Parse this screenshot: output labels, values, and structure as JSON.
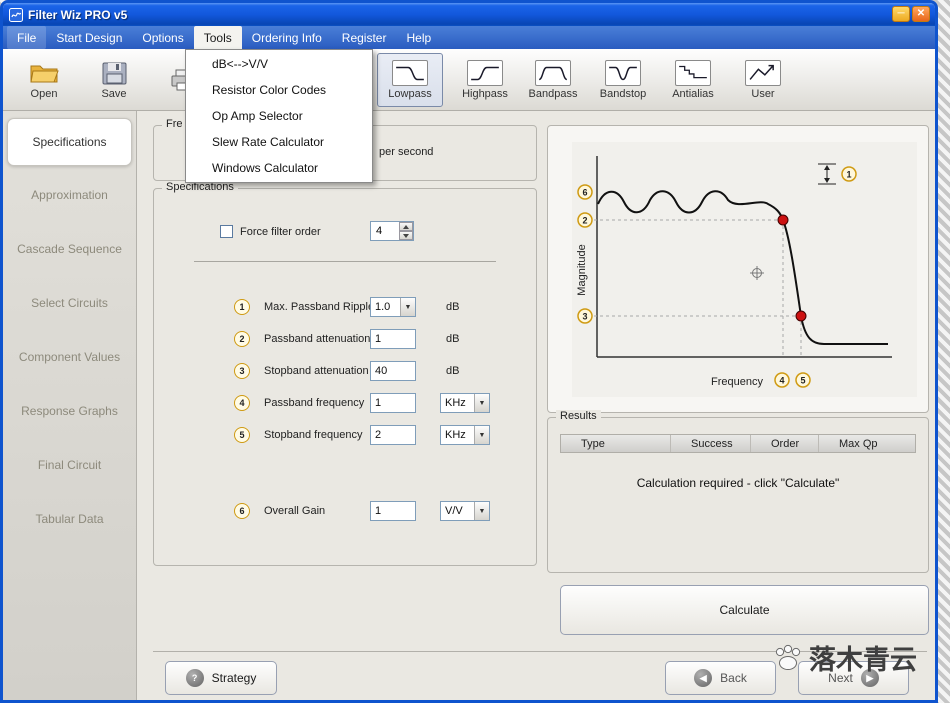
{
  "window": {
    "title": "Filter Wiz PRO v5"
  },
  "menu": {
    "items": [
      {
        "label": "File"
      },
      {
        "label": "Start Design"
      },
      {
        "label": "Options"
      },
      {
        "label": "Tools",
        "open": true
      },
      {
        "label": "Ordering Info"
      },
      {
        "label": "Register"
      },
      {
        "label": "Help"
      }
    ],
    "dropdown": [
      "dB<-->V/V",
      "Resistor Color Codes",
      "Op Amp Selector",
      "Slew Rate Calculator",
      "Windows Calculator"
    ]
  },
  "toolbar": {
    "open_label": "Open",
    "save_label": "Save",
    "filters": [
      {
        "label": "Lowpass",
        "selected": true
      },
      {
        "label": "Highpass",
        "selected": false
      },
      {
        "label": "Bandpass",
        "selected": false
      },
      {
        "label": "Bandstop",
        "selected": false
      },
      {
        "label": "Antialias",
        "selected": false
      },
      {
        "label": "User",
        "selected": false
      }
    ]
  },
  "sidebar": {
    "items": [
      {
        "label": "Specifications",
        "active": true
      },
      {
        "label": "Approximation",
        "active": false
      },
      {
        "label": "Cascade Sequence",
        "active": false
      },
      {
        "label": "Select Circuits",
        "active": false
      },
      {
        "label": "Component Values",
        "active": false
      },
      {
        "label": "Response Graphs",
        "active": false
      },
      {
        "label": "Final Circuit",
        "active": false
      },
      {
        "label": "Tabular Data",
        "active": false
      }
    ]
  },
  "frequency_units": {
    "label": "Fre",
    "visible_text": "per second"
  },
  "specifications": {
    "label": "Specifications",
    "force_filter_order": {
      "label": "Force filter order",
      "value": "4",
      "checked": false
    },
    "rows": [
      {
        "num": "1",
        "label": "Max. Passband Ripple",
        "value": "1.0",
        "unit": "dB"
      },
      {
        "num": "2",
        "label": "Passband attenuation",
        "value": "1",
        "unit": "dB"
      },
      {
        "num": "3",
        "label": "Stopband attenuation",
        "value": "40",
        "unit": "dB"
      },
      {
        "num": "4",
        "label": "Passband frequency",
        "value": "1",
        "unit": "KHz"
      },
      {
        "num": "5",
        "label": "Stopband frequency",
        "value": "2",
        "unit": "KHz"
      },
      {
        "num": "6",
        "label": "Overall Gain",
        "value": "1",
        "unit": "V/V"
      }
    ]
  },
  "graph": {
    "ylabel": "Magnitude",
    "xlabel": "Frequency",
    "markers": {
      "m1": "1",
      "m2": "2",
      "m3": "3",
      "m4": "4",
      "m5": "5",
      "m6": "6"
    },
    "accent_dot_color": "#cc1111",
    "marker_ring_color": "#cf9a12"
  },
  "results": {
    "label": "Results",
    "columns": [
      "Type",
      "Success",
      "Order",
      "Max Qp"
    ],
    "message": "Calculation required - click \"Calculate\""
  },
  "calculate": {
    "label": "Calculate"
  },
  "footer": {
    "strategy": "Strategy",
    "back": "Back",
    "next": "Next"
  },
  "watermark": {
    "text": "落木青云"
  }
}
